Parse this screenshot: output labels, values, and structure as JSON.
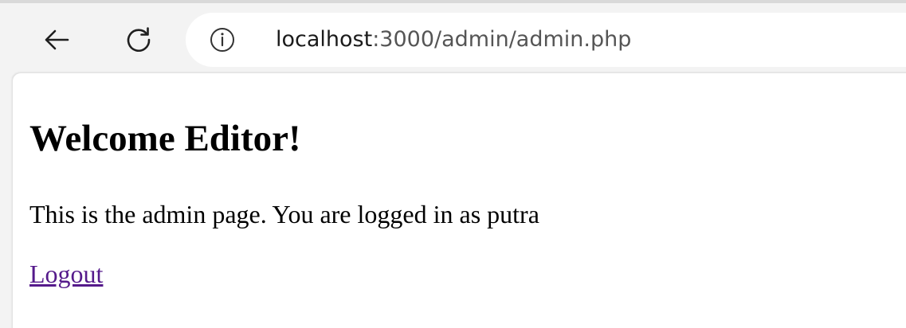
{
  "browser": {
    "url_host": "localhost",
    "url_path": ":3000/admin/admin.php",
    "icons": {
      "back": "back-arrow-icon",
      "reload": "reload-icon",
      "site_info": "info-icon"
    }
  },
  "page": {
    "heading": "Welcome Editor!",
    "message": "This is the admin page. You are logged in as putra",
    "logout_label": "Logout",
    "link_color": "#551a8b"
  }
}
